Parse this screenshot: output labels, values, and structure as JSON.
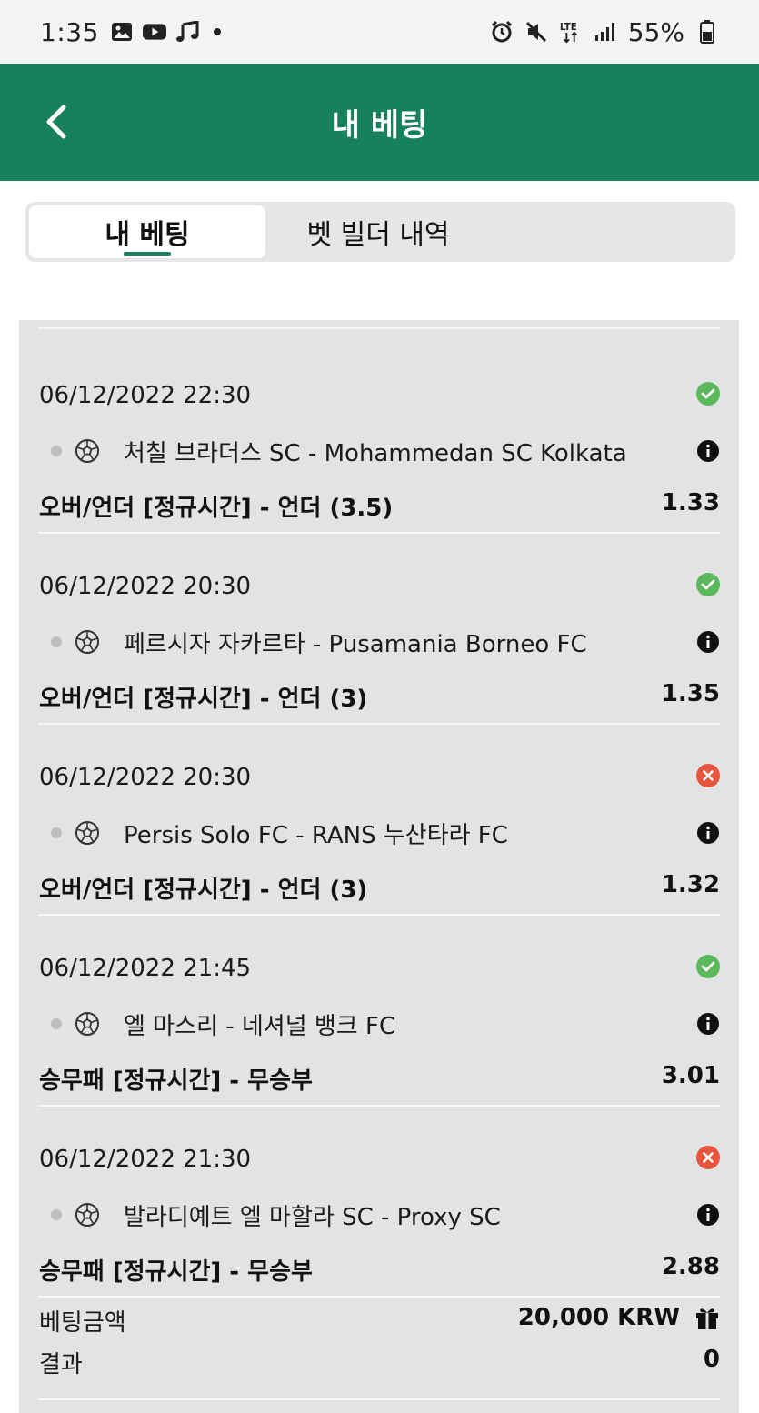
{
  "statusbar": {
    "time": "1:35",
    "battery": "55%",
    "icons_left": [
      "gallery-icon",
      "youtube-icon",
      "music-icon"
    ],
    "icons_right": [
      "alarm-icon",
      "mute-icon",
      "lte-icon",
      "signal-icon",
      "battery-icon"
    ],
    "network": "LTE"
  },
  "header": {
    "title": "내 베팅",
    "accent_color": "#17805c"
  },
  "tabs": [
    {
      "label": "내 베팅",
      "active": true
    },
    {
      "label": "벳 빌더 내역",
      "active": false
    }
  ],
  "bets": [
    {
      "date": "06/12/2022 22:30",
      "status": "won",
      "match": "처칠 브라더스 SC - Mohammedan SC Kolkata",
      "market": "오버/언더 [정규시간] - 언더 (3.5)",
      "odds": "1.33"
    },
    {
      "date": "06/12/2022 20:30",
      "status": "won",
      "match": "페르시자 자카르타 - Pusamania Borneo FC",
      "market": "오버/언더 [정규시간] - 언더 (3)",
      "odds": "1.35"
    },
    {
      "date": "06/12/2022 20:30",
      "status": "lost",
      "match": "Persis Solo FC - RANS 누산타라 FC",
      "market": "오버/언더 [정규시간] - 언더 (3)",
      "odds": "1.32"
    },
    {
      "date": "06/12/2022 21:45",
      "status": "won",
      "match": "엘 마스리 - 네셔널 뱅크 FC",
      "market": "승무패 [정규시간] - 무승부",
      "odds": "3.01"
    },
    {
      "date": "06/12/2022 21:30",
      "status": "lost",
      "match": "발라디예트 엘 마할라 SC - Proxy SC",
      "market": "승무패 [정규시간] - 무승부",
      "odds": "2.88"
    }
  ],
  "summary": {
    "stake_label": "베팅금액",
    "stake_value": "20,000 KRW",
    "result_label": "결과",
    "result_value": "0"
  },
  "colors": {
    "won": "#5cb85c",
    "lost": "#e8553f"
  }
}
